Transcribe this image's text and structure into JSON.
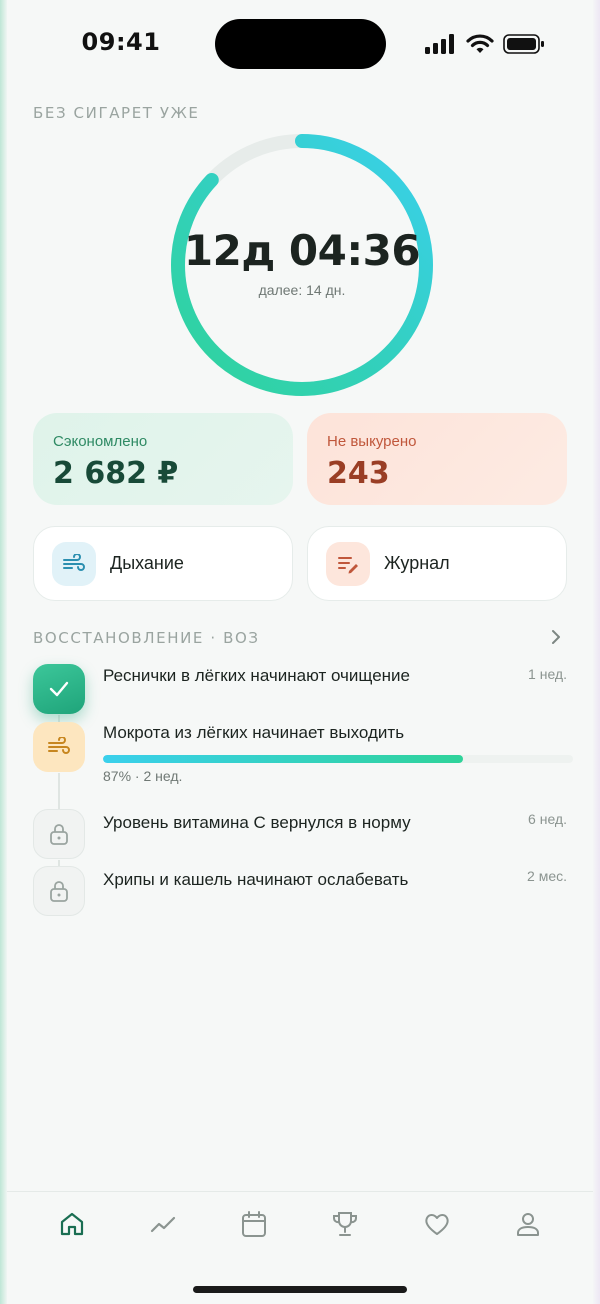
{
  "status_bar": {
    "time": "09:41"
  },
  "counter": {
    "label": "БЕЗ СИГАРЕТ УЖЕ",
    "elapsed": "12д 04:36",
    "next": "далее: 14 дн.",
    "progress": 0.87
  },
  "stats": {
    "saved_title": "Сэкономлено",
    "saved_value": "2 682 ₽",
    "not_smoked_title": "Не выкурено",
    "not_smoked_value": "243"
  },
  "actions": {
    "breathing_label": "Дыхание",
    "journal_label": "Журнал"
  },
  "recovery": {
    "label": "ВОССТАНОВЛЕНИЕ · ВОЗ",
    "milestones": [
      {
        "title": "Реснички в лёгких начинают очищение",
        "when": "1 нед.",
        "state": "done"
      },
      {
        "title": "Мокрота из лёгких начинает выходить",
        "progress_text": "87% · 2 нед.",
        "progress": 0.87,
        "state": "active"
      },
      {
        "title": "Уровень витамина С вернулся в норму",
        "when": "6 нед.",
        "state": "locked"
      },
      {
        "title": "Хрипы и кашель начинают ослабевать",
        "when": "2 мес.",
        "state": "locked"
      }
    ]
  },
  "tabs": [
    "home-icon",
    "trend-icon",
    "calendar-icon",
    "trophy-icon",
    "heart-icon",
    "profile-icon"
  ],
  "colors": {
    "accent_green": "#1fa47a",
    "accent_cyan": "#3ad0ec",
    "active_tab": "#1a6e52",
    "inactive_tab": "#8b9490"
  }
}
